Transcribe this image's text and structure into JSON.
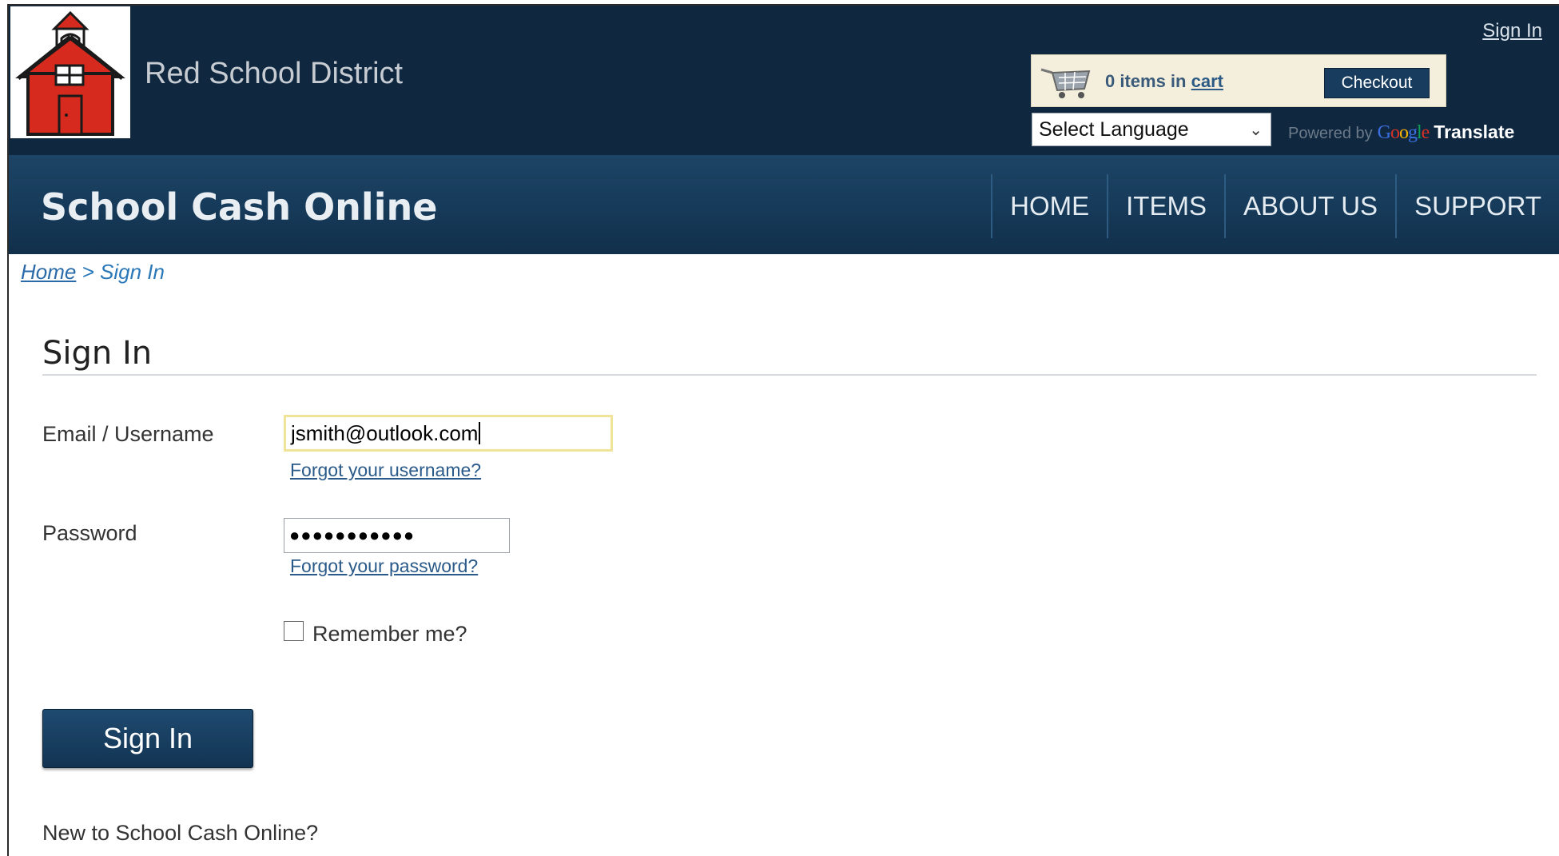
{
  "header": {
    "district_name": "Red School District",
    "top_signin": "Sign In",
    "cart": {
      "count_text": "0 items in",
      "cart_link": "cart",
      "checkout_label": "Checkout"
    },
    "language_select": {
      "selected": "Select Language"
    },
    "powered_by": {
      "prefix": "Powered by",
      "google": "Google",
      "translate": "Translate"
    }
  },
  "nav": {
    "app_title": "School Cash Online",
    "items": [
      "HOME",
      "ITEMS",
      "ABOUT US",
      "SUPPORT"
    ]
  },
  "breadcrumb": {
    "home": "Home",
    "separator": ">",
    "current": "Sign In"
  },
  "form": {
    "title": "Sign In",
    "email_label": "Email / Username",
    "email_value": "jsmith@outlook.com",
    "forgot_username": "Forgot your username?",
    "password_label": "Password",
    "password_value": "●●●●●●●●●●●",
    "forgot_password": "Forgot your password?",
    "remember_label": "Remember me?",
    "remember_checked": false,
    "submit_label": "Sign In",
    "new_user_text": "New to School Cash Online?"
  },
  "colors": {
    "header_bg": "#0f2840",
    "nav_bg": "#163a59",
    "accent_link": "#2a78b8",
    "focus_border": "#efe49a",
    "logo_red": "#d72a1e"
  },
  "icons": [
    "schoolhouse-logo",
    "cart-icon",
    "chevron-down-icon",
    "checkbox"
  ]
}
